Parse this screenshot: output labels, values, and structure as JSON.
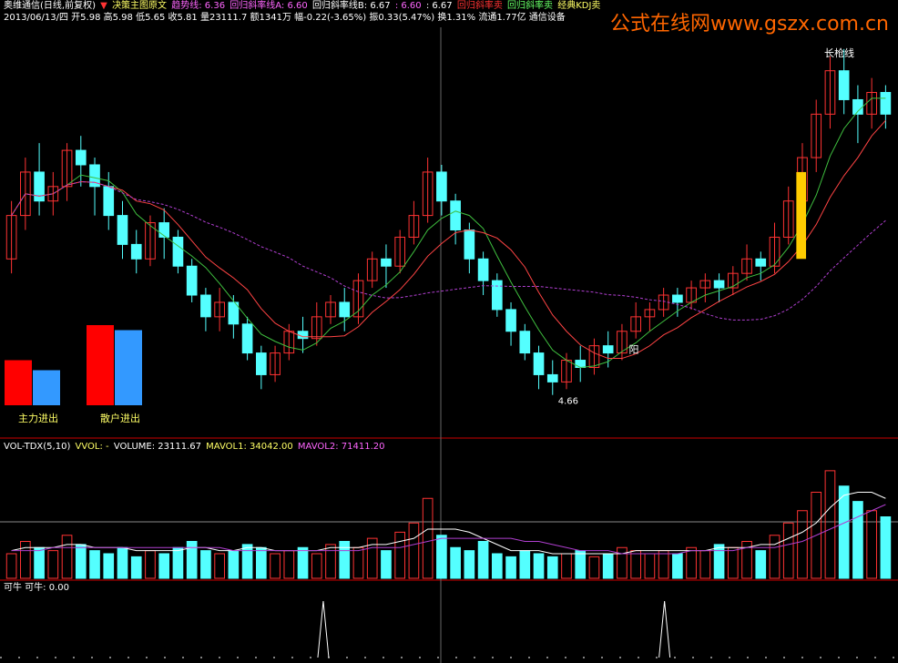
{
  "colors": {
    "background": "#000000",
    "up": "#ff3333",
    "down": "#54ffff",
    "ma_slow_up": "#ffffff",
    "ma_green": "#3fbf3f",
    "ma_red": "#ff4444",
    "ma_purple": "#b03fd0",
    "divider": "#cc0000",
    "watermark": "#ff6600",
    "highlight_bar": "#ffcc00",
    "vol_up_line": "#ff9999"
  },
  "header": {
    "title": "奥维通信(日线,前复权)",
    "indicator": "决策主图原文",
    "trend_label": "趋势线: 6.36",
    "reg_a": "回归斜率线A: 6.60",
    "reg_b": "回归斜率线B: 6.67",
    "v1": ": 6.60",
    "v2": ": 6.67",
    "sell1": "回归斜率卖",
    "sell2": "回归斜率卖",
    "sell3": "经典KDJ卖",
    "row2": "2013/06/13/四 开5.98 高5.98 低5.65 收5.81 量23111.7 额1341万 幅-0.22(-3.65%) 振0.33(5.47%) 换1.31% 流通1.77亿 通信设备"
  },
  "watermark": "公式在线网www.gszx.com.cn",
  "annotations": {
    "low_label": "4.66",
    "yang_label": "阳",
    "top_label": "长枪线"
  },
  "flow_boxes": {
    "main_label": "主力进出",
    "retail_label": "散户进出",
    "group1": [
      {
        "color": "up",
        "value": 0.45
      },
      {
        "color": "down",
        "value": 0.35
      }
    ],
    "group2": [
      {
        "color": "up",
        "value": 0.8
      },
      {
        "color": "down",
        "value": 0.75
      }
    ]
  },
  "volume_header": {
    "name": "VOL-TDX(5,10)",
    "vvol": "VVOL: -",
    "volume": "VOLUME: 23111.67",
    "mavol1": "MAVOL1: 34042.00",
    "mavol2": "MAVOL2: 71411.20"
  },
  "bottom_header": {
    "label": "可牛 可牛: 0.00"
  },
  "chart_data": {
    "type": "candlestick",
    "y_range": [
      4.4,
      7.2
    ],
    "low_price": 4.66,
    "candles": [
      [
        5.6,
        5.9,
        5.5,
        6.0
      ],
      [
        5.9,
        6.2,
        5.8,
        6.3
      ],
      [
        6.2,
        6.0,
        5.9,
        6.4
      ],
      [
        6.0,
        6.1,
        5.9,
        6.2
      ],
      [
        6.1,
        6.35,
        6.0,
        6.4
      ],
      [
        6.35,
        6.25,
        6.1,
        6.45
      ],
      [
        6.25,
        6.1,
        5.9,
        6.3
      ],
      [
        6.1,
        5.9,
        5.8,
        6.2
      ],
      [
        5.9,
        5.7,
        5.6,
        6.0
      ],
      [
        5.7,
        5.6,
        5.5,
        5.8
      ],
      [
        5.6,
        5.85,
        5.55,
        5.9
      ],
      [
        5.85,
        5.75,
        5.6,
        5.95
      ],
      [
        5.75,
        5.55,
        5.5,
        5.8
      ],
      [
        5.55,
        5.35,
        5.3,
        5.6
      ],
      [
        5.35,
        5.2,
        5.1,
        5.4
      ],
      [
        5.2,
        5.3,
        5.1,
        5.4
      ],
      [
        5.3,
        5.15,
        5.05,
        5.35
      ],
      [
        5.15,
        4.95,
        4.9,
        5.2
      ],
      [
        4.95,
        4.8,
        4.7,
        5.0
      ],
      [
        4.8,
        4.95,
        4.75,
        5.0
      ],
      [
        4.95,
        5.1,
        4.9,
        5.15
      ],
      [
        5.1,
        5.05,
        4.95,
        5.2
      ],
      [
        5.05,
        5.2,
        5.0,
        5.3
      ],
      [
        5.2,
        5.3,
        5.15,
        5.35
      ],
      [
        5.3,
        5.2,
        5.1,
        5.4
      ],
      [
        5.2,
        5.45,
        5.15,
        5.5
      ],
      [
        5.45,
        5.6,
        5.4,
        5.65
      ],
      [
        5.6,
        5.55,
        5.4,
        5.7
      ],
      [
        5.55,
        5.75,
        5.5,
        5.8
      ],
      [
        5.75,
        5.9,
        5.7,
        6.0
      ],
      [
        5.9,
        6.2,
        5.85,
        6.3
      ],
      [
        6.2,
        6.0,
        5.9,
        6.25
      ],
      [
        6.0,
        5.8,
        5.7,
        6.05
      ],
      [
        5.8,
        5.6,
        5.5,
        5.85
      ],
      [
        5.6,
        5.45,
        5.35,
        5.65
      ],
      [
        5.45,
        5.25,
        5.2,
        5.5
      ],
      [
        5.25,
        5.1,
        5.0,
        5.3
      ],
      [
        5.1,
        4.95,
        4.9,
        5.15
      ],
      [
        4.95,
        4.8,
        4.7,
        5.0
      ],
      [
        4.8,
        4.75,
        4.66,
        4.9
      ],
      [
        4.75,
        4.9,
        4.7,
        4.95
      ],
      [
        4.9,
        4.85,
        4.75,
        5.0
      ],
      [
        4.85,
        5.0,
        4.8,
        5.05
      ],
      [
        5.0,
        4.95,
        4.85,
        5.1
      ],
      [
        4.95,
        5.1,
        4.9,
        5.15
      ],
      [
        5.1,
        5.2,
        5.05,
        5.3
      ],
      [
        5.2,
        5.25,
        5.1,
        5.3
      ],
      [
        5.25,
        5.35,
        5.2,
        5.4
      ],
      [
        5.35,
        5.3,
        5.2,
        5.4
      ],
      [
        5.3,
        5.4,
        5.25,
        5.45
      ],
      [
        5.4,
        5.45,
        5.3,
        5.5
      ],
      [
        5.45,
        5.4,
        5.3,
        5.5
      ],
      [
        5.4,
        5.5,
        5.35,
        5.55
      ],
      [
        5.5,
        5.6,
        5.45,
        5.7
      ],
      [
        5.6,
        5.55,
        5.45,
        5.65
      ],
      [
        5.55,
        5.75,
        5.5,
        5.85
      ],
      [
        5.75,
        6.0,
        5.7,
        6.1
      ],
      [
        6.0,
        6.3,
        5.95,
        6.4
      ],
      [
        6.3,
        6.6,
        6.2,
        6.7
      ],
      [
        6.6,
        6.9,
        6.5,
        7.0
      ],
      [
        6.9,
        6.7,
        6.6,
        7.05
      ],
      [
        6.7,
        6.6,
        6.4,
        6.8
      ],
      [
        6.6,
        6.75,
        6.5,
        6.85
      ],
      [
        6.75,
        6.6,
        6.5,
        6.8
      ]
    ],
    "volume": [
      8,
      12,
      10,
      9,
      14,
      11,
      9,
      8,
      10,
      7,
      9,
      8,
      10,
      12,
      9,
      8,
      9,
      11,
      10,
      8,
      9,
      10,
      8,
      11,
      12,
      10,
      13,
      9,
      15,
      18,
      26,
      14,
      10,
      9,
      12,
      8,
      7,
      9,
      8,
      7,
      8,
      9,
      7,
      8,
      10,
      9,
      8,
      9,
      8,
      10,
      9,
      11,
      10,
      12,
      9,
      14,
      18,
      22,
      28,
      35,
      30,
      25,
      22,
      20
    ],
    "vol_ma1": [
      9,
      10,
      10,
      10,
      11,
      11,
      10,
      10,
      10,
      9,
      9,
      9,
      9,
      10,
      10,
      9,
      9,
      10,
      10,
      9,
      9,
      9,
      9,
      10,
      10,
      10,
      11,
      11,
      12,
      13,
      16,
      16,
      16,
      15,
      13,
      11,
      9,
      9,
      9,
      8,
      8,
      8,
      8,
      8,
      8,
      9,
      9,
      9,
      9,
      9,
      9,
      10,
      10,
      10,
      11,
      11,
      13,
      15,
      18,
      23,
      27,
      28,
      28,
      26
    ],
    "vol_ma2": [
      9,
      9,
      9,
      10,
      10,
      10,
      10,
      10,
      10,
      10,
      10,
      10,
      10,
      10,
      10,
      10,
      9,
      9,
      9,
      9,
      9,
      9,
      9,
      9,
      9,
      9,
      10,
      10,
      10,
      11,
      12,
      13,
      13,
      13,
      13,
      13,
      13,
      12,
      12,
      11,
      10,
      9,
      9,
      9,
      8,
      8,
      8,
      8,
      8,
      9,
      9,
      9,
      9,
      10,
      10,
      10,
      11,
      12,
      14,
      16,
      18,
      20,
      22,
      24
    ],
    "kn_spikes": [
      0.36,
      0.74
    ]
  }
}
